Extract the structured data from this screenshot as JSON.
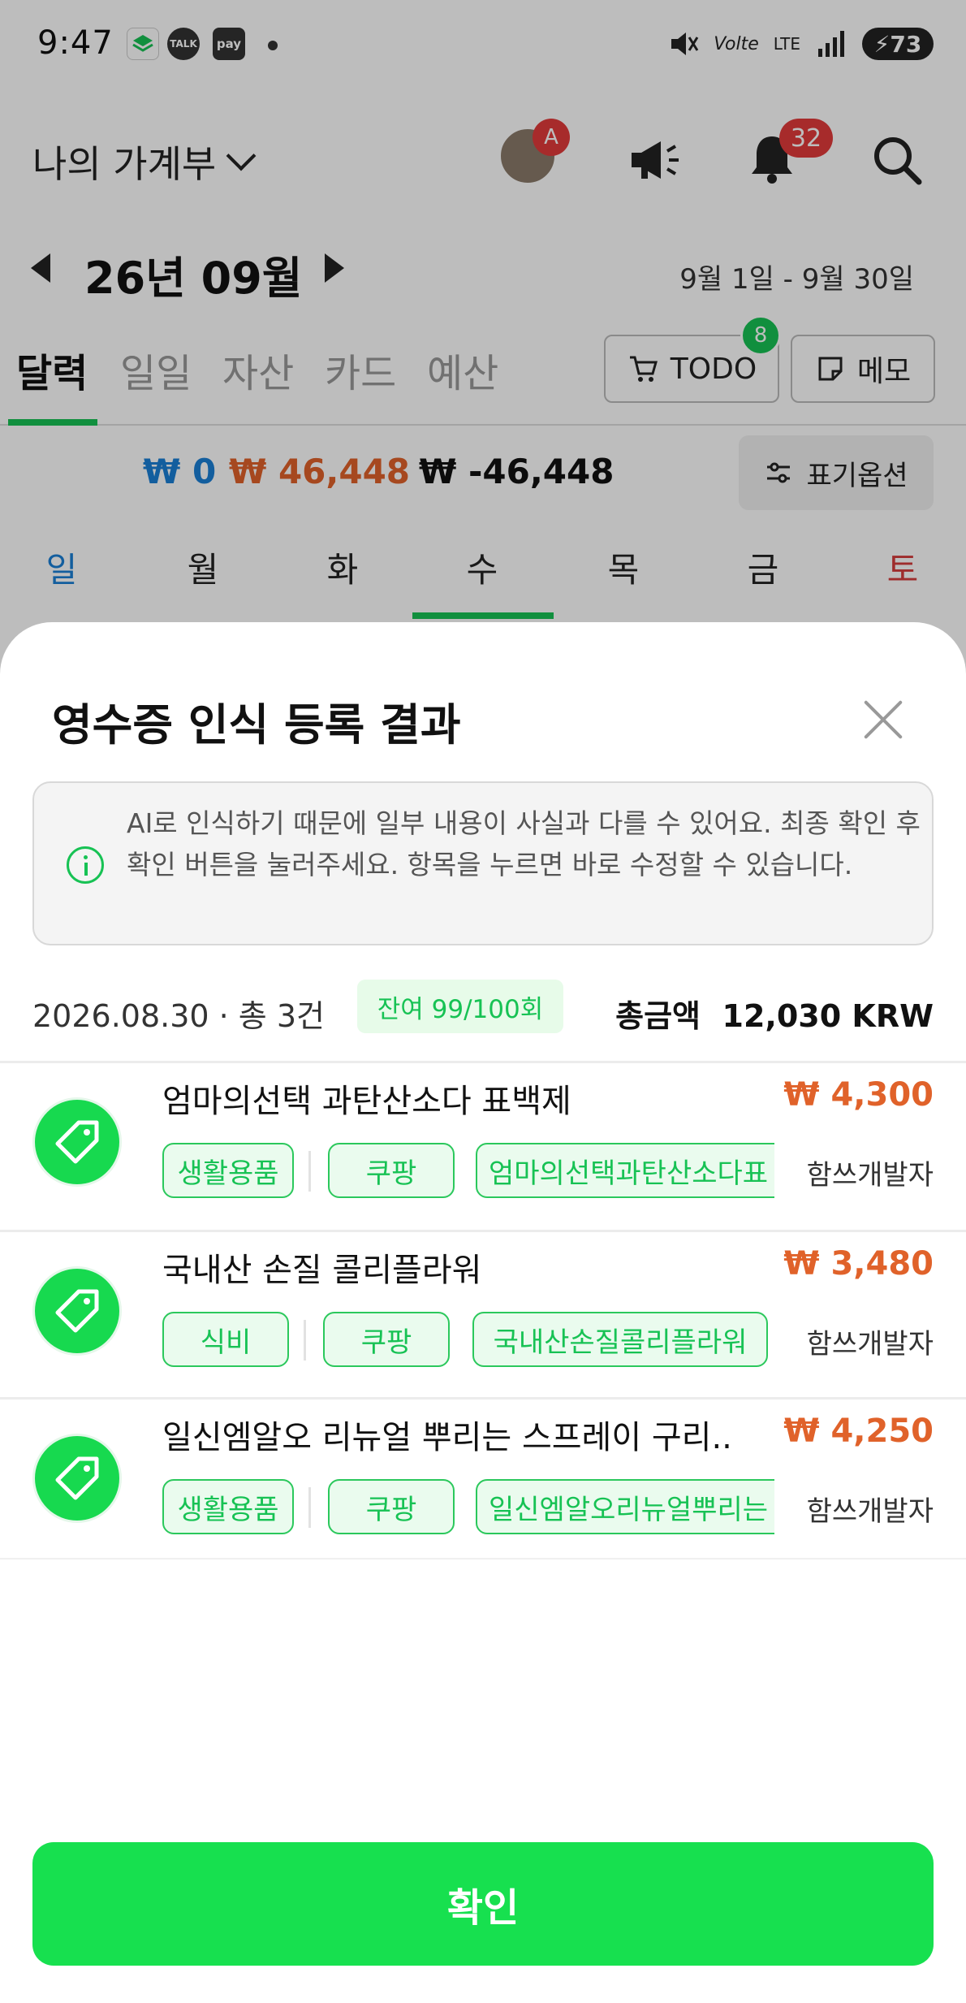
{
  "status_bar": {
    "time": "9:47",
    "app_icons": [
      "TALK",
      "pay"
    ],
    "network": "LTE",
    "battery": "73"
  },
  "header": {
    "book_title": "나의 가계부",
    "avatar_badge": "A",
    "notification_count": "32"
  },
  "month_nav": {
    "month": "26년 09월",
    "range": "9월 1일 - 9월 30일"
  },
  "tabs": [
    "달력",
    "일일",
    "자산",
    "카드",
    "예산"
  ],
  "todo": {
    "label": "TODO",
    "badge": "8"
  },
  "memo": {
    "label": "메모"
  },
  "totals": {
    "income": "₩ 0",
    "expense": "₩ 46,448",
    "balance": "₩ -46,448",
    "display_option": "표기옵션"
  },
  "weekdays": [
    "일",
    "월",
    "화",
    "수",
    "목",
    "금",
    "토"
  ],
  "sheet": {
    "title": "영수증 인식 등록 결과",
    "notice": "AI로 인식하기 때문에 일부 내용이 사실과 다를 수 있어요. 최종 확인 후 확인 버튼을 눌러주세요. 항목을 누르면 바로 수정할 수 있습니다.",
    "date_count": "2026.08.30 · 총 3건",
    "remaining": "잔여 99/100회",
    "total_label": "총금액",
    "total_value": "12,030 KRW",
    "confirm": "확인"
  },
  "items": [
    {
      "title": "엄마의선택 과탄산소다 표백제",
      "price": "₩ 4,300",
      "category": "생활용품",
      "store": "쿠팡",
      "memo": "엄마의선택과탄산소다표",
      "user": "함쓰개발자"
    },
    {
      "title": "국내산 손질 콜리플라워",
      "price": "₩ 3,480",
      "category": "식비",
      "store": "쿠팡",
      "memo": "국내산손질콜리플라워",
      "user": "함쓰개발자"
    },
    {
      "title": "일신엠알오 리뉴얼 뿌리는 스프레이 구리..",
      "price": "₩ 4,250",
      "category": "생활용품",
      "store": "쿠팡",
      "memo": "일신엠알오리뉴얼뿌리는",
      "user": "함쓰개발자"
    }
  ],
  "colors": {
    "accent_green": "#17c254",
    "income_blue": "#1a7fd6",
    "expense_orange": "#e0622a",
    "badge_red": "#e23b3b"
  }
}
